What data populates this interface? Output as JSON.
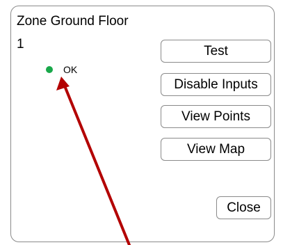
{
  "panel": {
    "title": "Zone Ground Floor",
    "zone_number": "1",
    "status": {
      "label": "OK",
      "color": "#19a84a"
    }
  },
  "buttons": {
    "test": "Test",
    "disable_inputs": "Disable Inputs",
    "view_points": "View Points",
    "view_map": "View Map",
    "close": "Close"
  },
  "annotation": {
    "type": "arrow",
    "color": "#b30000",
    "points_to": "status-indicator"
  }
}
